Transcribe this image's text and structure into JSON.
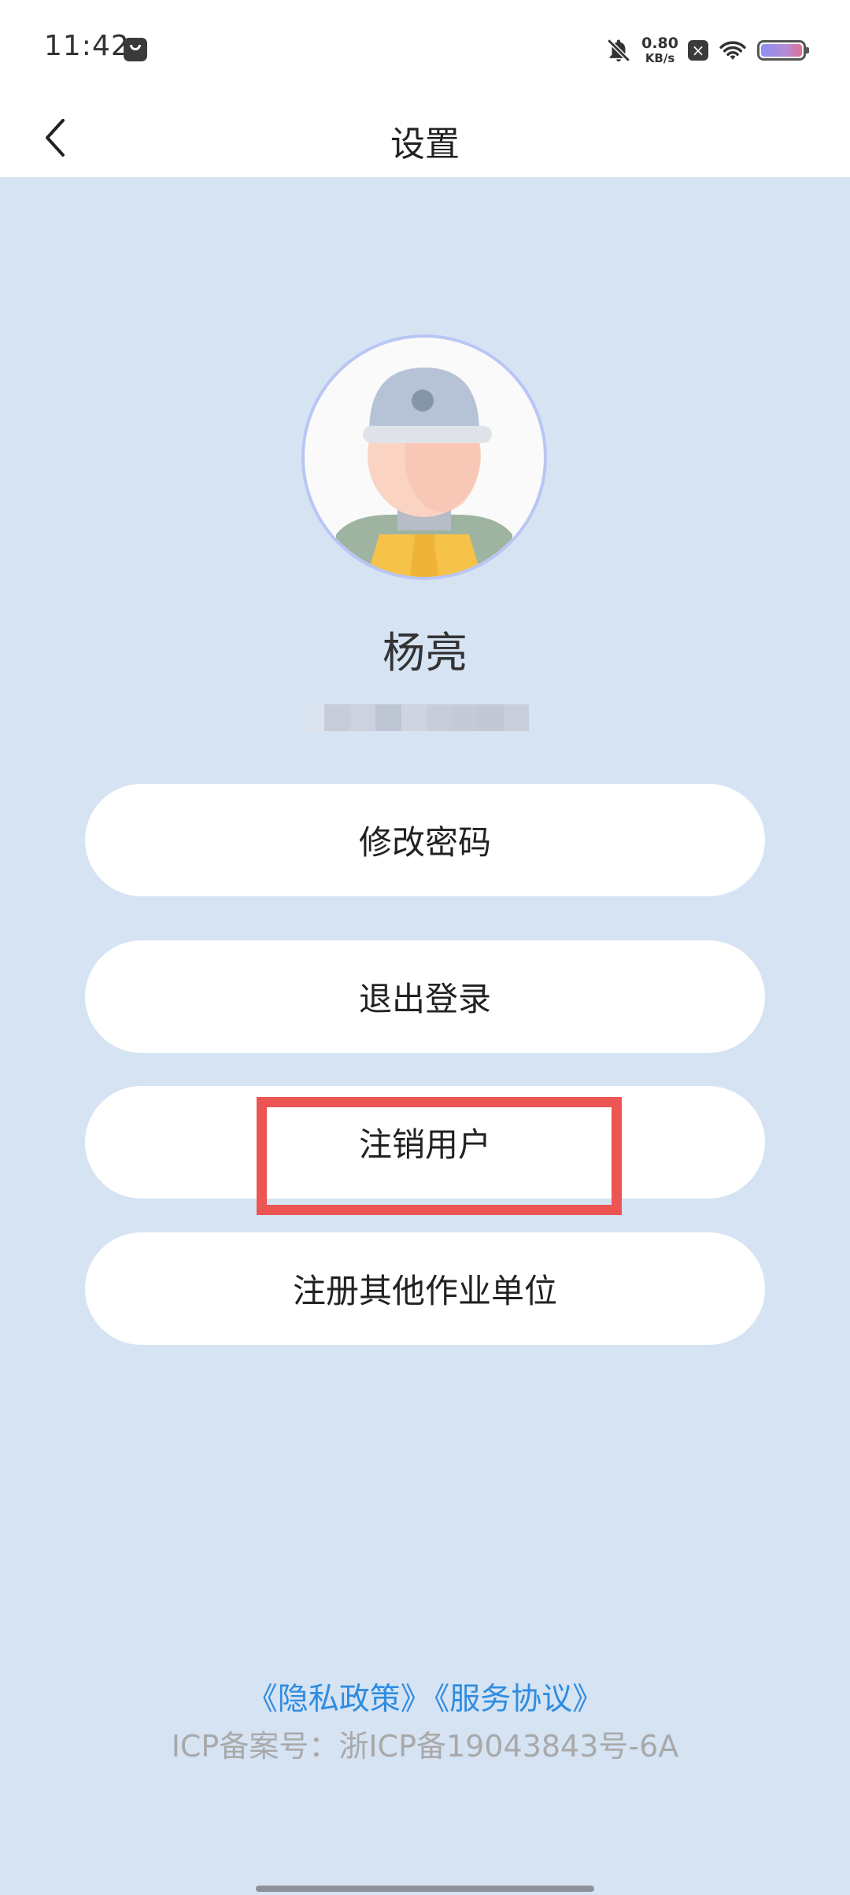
{
  "status_bar": {
    "time": "11:42",
    "net_speed_value": "0.80",
    "net_speed_unit": "KB/s",
    "icons": [
      "app-notification-icon",
      "bell-mute-icon",
      "close-badge-icon",
      "wifi-icon",
      "battery-icon"
    ]
  },
  "header": {
    "title": "设置",
    "back_icon": "chevron-left-icon"
  },
  "profile": {
    "name": "杨亮",
    "avatar_icon": "worker-avatar-icon"
  },
  "actions": {
    "change_password": "修改密码",
    "logout": "退出登录",
    "deregister": "注销用户",
    "register_other_unit": "注册其他作业单位"
  },
  "footer": {
    "privacy_policy": "《隐私政策》",
    "service_agreement": "《服务协议》",
    "icp": "ICP备案号：浙ICP备19043843号-6A"
  },
  "colors": {
    "background": "#d5e3f3",
    "link": "#2f8ce0",
    "highlight": "#ec5552"
  }
}
